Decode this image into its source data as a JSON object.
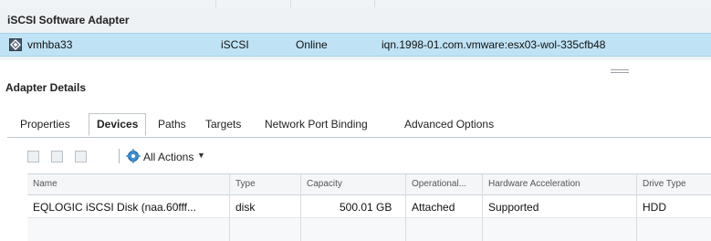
{
  "adapter_group": {
    "title": "iSCSI Software Adapter",
    "adapter": {
      "name": "vmhba33",
      "type": "iSCSI",
      "status": "Online",
      "identifier": "iqn.1998-01.com.vmware:esx03-wol-335cfb48",
      "icon": "adapter-icon"
    }
  },
  "details": {
    "title": "Adapter Details",
    "tabs": [
      {
        "label": "Properties",
        "active": false
      },
      {
        "label": "Devices",
        "active": true
      },
      {
        "label": "Paths",
        "active": false
      },
      {
        "label": "Targets",
        "active": false
      },
      {
        "label": "Network Port Binding",
        "active": false
      },
      {
        "label": "Advanced Options",
        "active": false
      }
    ],
    "toolbar": {
      "actions_label": "All Actions"
    },
    "grid": {
      "columns": [
        "Name",
        "Type",
        "Capacity",
        "Operational...",
        "Hardware Acceleration",
        "Drive Type"
      ],
      "rows": [
        {
          "name": "EQLOGIC iSCSI Disk (naa.60fff...",
          "type": "disk",
          "capacity": "500.01 GB",
          "operational": "Attached",
          "hw_accel": "Supported",
          "drive_type": "HDD"
        }
      ]
    }
  }
}
